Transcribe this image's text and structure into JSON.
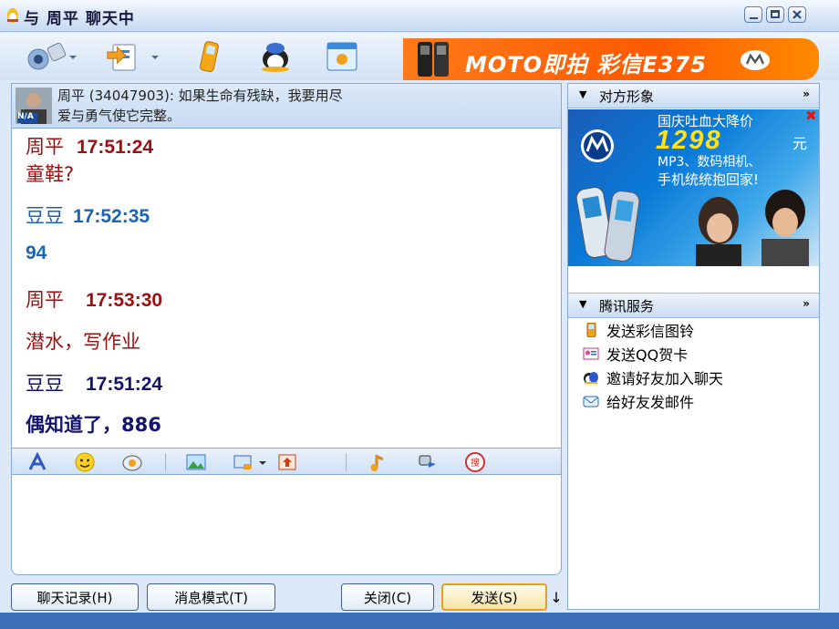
{
  "window": {
    "title": "与 周平 聊天中"
  },
  "toolbar": {
    "items": [
      {
        "name": "video-chat",
        "has_dropdown": true
      },
      {
        "name": "file-transfer",
        "has_dropdown": true
      },
      {
        "name": "mobile-sms",
        "has_dropdown": false
      },
      {
        "name": "qq-show",
        "has_dropdown": false
      },
      {
        "name": "app-panel",
        "has_dropdown": false
      }
    ],
    "ad": {
      "text": "MOTO即拍 彩信E375"
    }
  },
  "signature": {
    "avatar_badge": "N/A",
    "line1": "周平 (34047903): 如果生命有残缺，我要用尽",
    "line2": "爱与勇气使它完整。"
  },
  "messages": [
    {
      "sender": "周平",
      "time": "17:51:24",
      "text": "童鞋?",
      "color": "#9a1010"
    },
    {
      "sender": "豆豆",
      "time": "17:52:35",
      "text": "94",
      "color": "#1a63b5"
    },
    {
      "sender": "周平",
      "time": "17:53:30",
      "text": "潜水，写作业",
      "color": "#9a1010"
    },
    {
      "sender": "豆豆",
      "time": "17:51:24",
      "text": "偶知道了，886",
      "color": "#14146e"
    }
  ],
  "format_bar": {
    "icons": [
      "font-icon",
      "emoticon-icon",
      "magic-emoticon-icon",
      "send-image-icon",
      "screenshot-icon",
      "chevron-down-icon",
      "doodle-icon",
      "music-icon",
      "shake-icon",
      "search-icon"
    ]
  },
  "input": {
    "value": ""
  },
  "buttons": {
    "history": "聊天记录(H)",
    "mode": "消息模式(T)",
    "close": "关闭(C)",
    "send": "发送(S)",
    "send_arrow": "↓"
  },
  "right_panel": {
    "avatar_section": {
      "title": "对方形象",
      "more": "»"
    },
    "ad": {
      "line1": "国庆吐血大降价",
      "price": "1298",
      "price_unit": "元",
      "line2": "MP3、数码相机、",
      "line3": "手机统统抱回家!"
    },
    "services": {
      "title": "腾讯服务",
      "more": "»",
      "items": [
        {
          "label": "发送彩信图铃",
          "icon": "phone-icon"
        },
        {
          "label": "发送QQ贺卡",
          "icon": "card-icon"
        },
        {
          "label": "邀请好友加入聊天",
          "icon": "invite-icon"
        },
        {
          "label": "给好友发邮件",
          "icon": "mail-icon"
        }
      ]
    }
  },
  "colors": {
    "accent": "#3d6fb8",
    "ad_orange": "#ff6a00"
  }
}
